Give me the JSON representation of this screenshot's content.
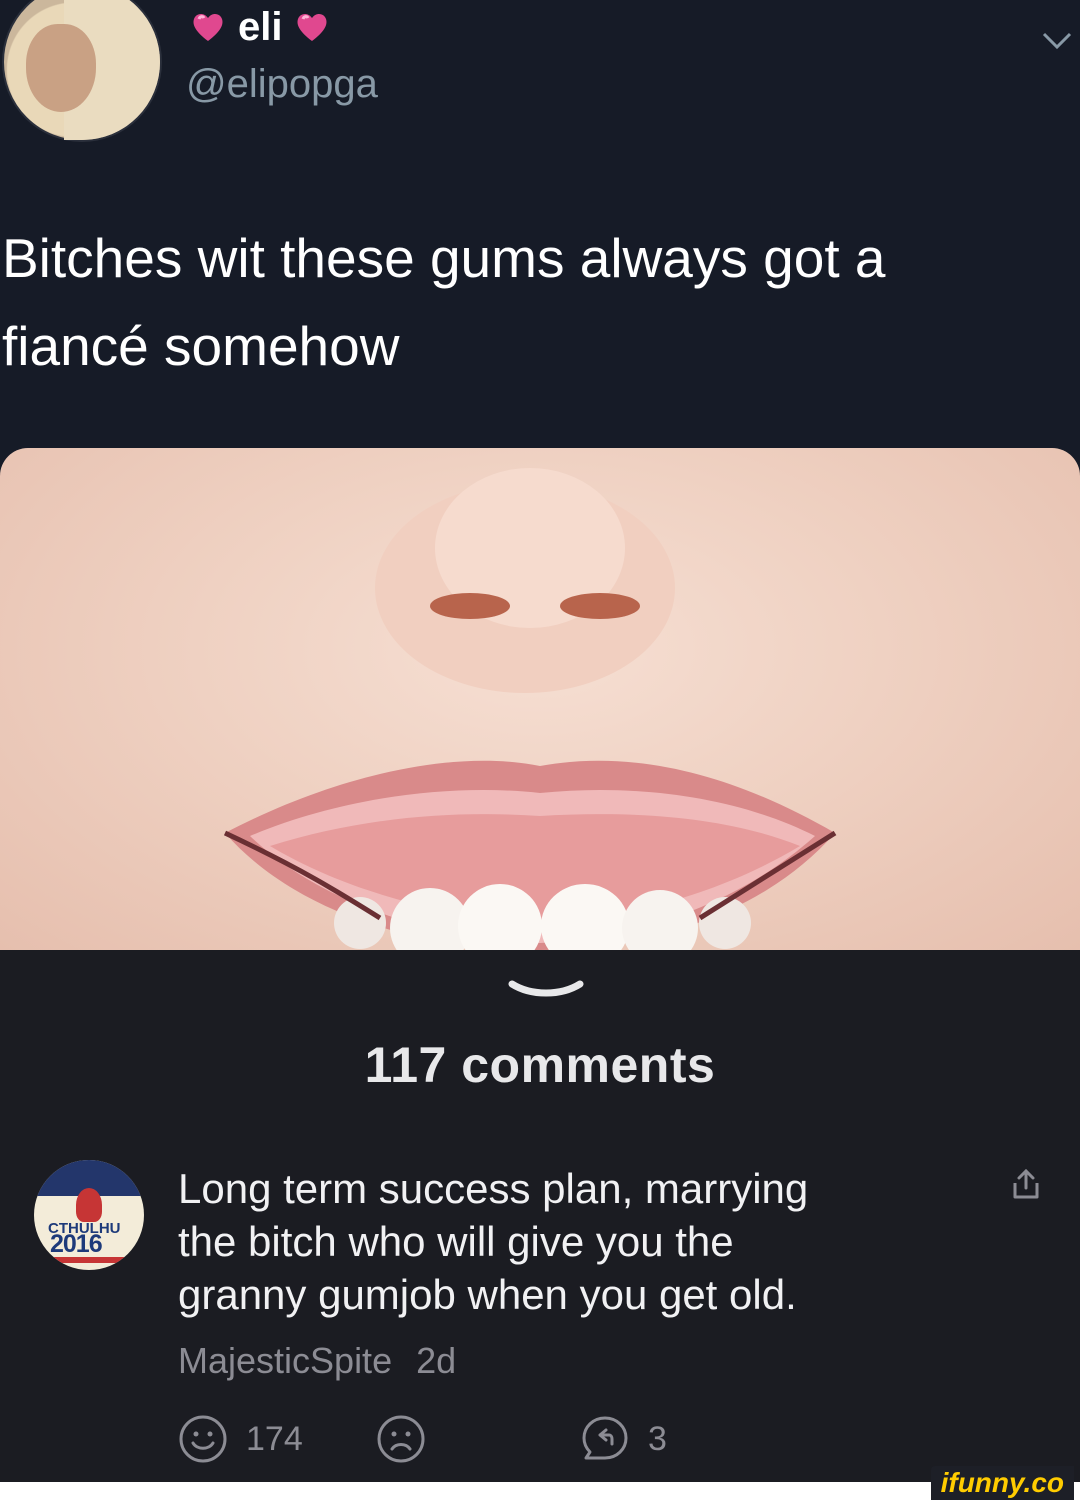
{
  "tweet": {
    "display_name": "eli",
    "name_decoration_icon": "pink-heart-icon",
    "handle": "@elipopga",
    "text": "Bitches wit these gums always got a\nfiancé somehow",
    "menu_icon": "chevron-down-icon",
    "image_icon": "smile-photo"
  },
  "comments_section": {
    "count_label": "117 comments",
    "collapse_icon": "chevron-down-icon"
  },
  "comment": {
    "avatar_text_line1": "CTHULHU",
    "avatar_text_line2": "2016",
    "text": "Long term success plan, marrying\nthe bitch who will give you the\ngranny gumjob when you get old.",
    "author": "MajesticSpite",
    "time": "2d",
    "share_icon": "share-icon",
    "smile_count": "174",
    "smile_icon": "smile-icon",
    "unsmile_icon": "frown-icon",
    "reply_icon": "reply-icon",
    "reply_count": "3"
  },
  "watermark": "ifunny.co",
  "colors": {
    "tweet_bg": "#161b27",
    "app_bg": "#1b1c22",
    "secondary_text": "#8c8c94",
    "handle_text": "#8899a6",
    "heart": "#e0488f",
    "brand": "#ffcc00"
  }
}
